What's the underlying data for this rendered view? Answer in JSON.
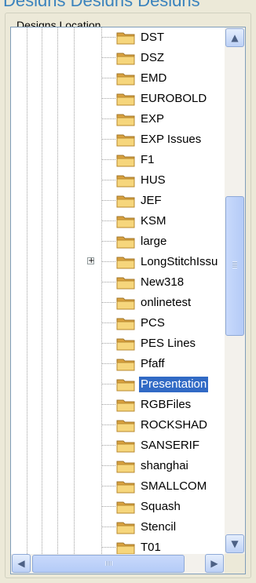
{
  "banner_text": "Designs Designs Designs",
  "group_title": "Designs Location",
  "tree": {
    "items": [
      {
        "label": "DST"
      },
      {
        "label": "DSZ"
      },
      {
        "label": "EMD"
      },
      {
        "label": "EUROBOLD"
      },
      {
        "label": "EXP"
      },
      {
        "label": "EXP Issues"
      },
      {
        "label": "F1"
      },
      {
        "label": "HUS"
      },
      {
        "label": "JEF"
      },
      {
        "label": "KSM"
      },
      {
        "label": "large"
      },
      {
        "label": "LongStitchIssu",
        "expandable": true
      },
      {
        "label": "New318"
      },
      {
        "label": "onlinetest"
      },
      {
        "label": "PCS"
      },
      {
        "label": "PES Lines"
      },
      {
        "label": "Pfaff"
      },
      {
        "label": "Presentation",
        "selected": true
      },
      {
        "label": "RGBFiles"
      },
      {
        "label": "ROCKSHAD"
      },
      {
        "label": "SANSERIF"
      },
      {
        "label": "shanghai"
      },
      {
        "label": "SMALLCOM"
      },
      {
        "label": "Squash"
      },
      {
        "label": "Stencil"
      },
      {
        "label": "T01"
      }
    ],
    "expand_glyph": "+",
    "selected_color": "#316ac5"
  },
  "scrollbar": {
    "up_icon": "▲",
    "down_icon": "▼",
    "left_icon": "◀",
    "right_icon": "▶"
  }
}
